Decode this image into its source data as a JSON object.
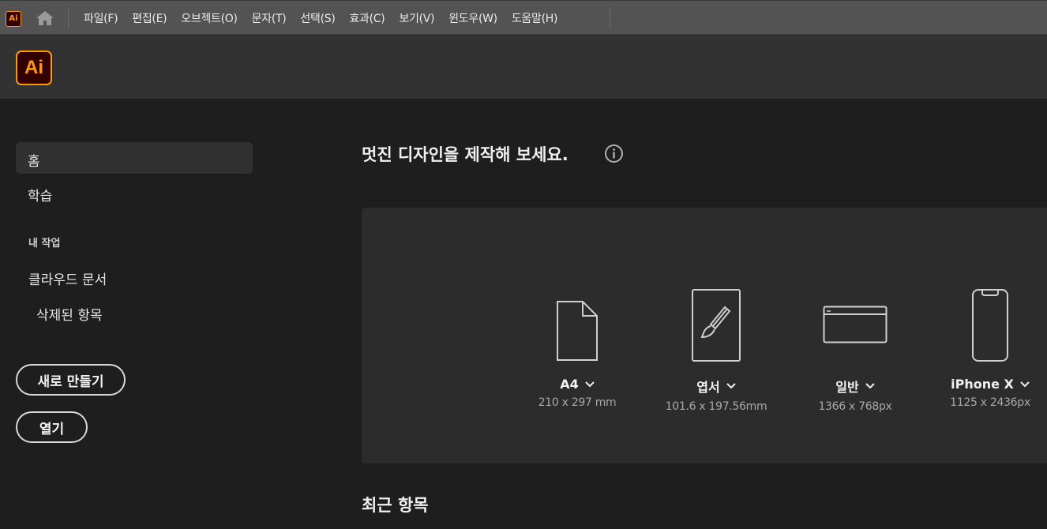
{
  "menubar": {
    "app_badge": "Ai",
    "items": [
      "파일(F)",
      "편집(E)",
      "오브젝트(O)",
      "문자(T)",
      "선택(S)",
      "효과(C)",
      "보기(V)",
      "윈도우(W)",
      "도움말(H)"
    ]
  },
  "header": {
    "logo": "Ai"
  },
  "sidebar": {
    "home": "홈",
    "learn": "학습",
    "section_label": "내 작업",
    "cloud_docs": "클라우드 문서",
    "deleted_items": "삭제된 항목",
    "new_button": "새로 만들기",
    "open_button": "열기"
  },
  "main": {
    "title": "멋진 디자인을 제작해 보세요.",
    "presets": [
      {
        "label": "A4",
        "dims": "210 x 297 mm",
        "icon": "document-icon"
      },
      {
        "label": "엽서",
        "dims": "101.6 x 197.56mm",
        "icon": "postcard-brush-icon"
      },
      {
        "label": "일반",
        "dims": "1366 x 768px",
        "icon": "browser-window-icon"
      },
      {
        "label": "iPhone X",
        "dims": "1125 x 2436px",
        "icon": "phone-icon"
      }
    ],
    "recent_title": "최근 항목"
  },
  "colors": {
    "accent": "#ff9a00",
    "logo_bg": "#330000",
    "menubar_bg": "#535353",
    "header_bg": "#323232",
    "body_bg": "#1e1e1e",
    "panel_bg": "#2c2c2c"
  }
}
